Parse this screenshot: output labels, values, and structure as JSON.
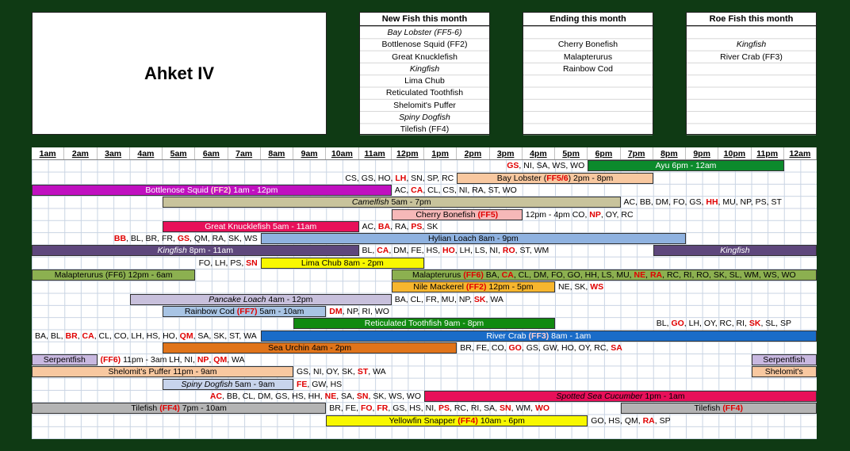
{
  "title": "Ahket IV",
  "panels": [
    {
      "key": "new",
      "header": "New Fish this month",
      "items": [
        {
          "t": "Bay Lobster (FF5-6)",
          "i": true
        },
        {
          "t": "Bottlenose Squid (FF2)",
          "i": false
        },
        {
          "t": "Great Knucklefish",
          "i": false
        },
        {
          "t": "Kingfish",
          "i": true
        },
        {
          "t": "Lima Chub",
          "i": false
        },
        {
          "t": "Reticulated Toothfish",
          "i": false
        },
        {
          "t": "Shelomit's Puffer",
          "i": false
        },
        {
          "t": "Spiny Dogfish",
          "i": true
        },
        {
          "t": "Tilefish (FF4)",
          "i": false
        }
      ]
    },
    {
      "key": "ending",
      "header": "Ending this month",
      "items": [
        {
          "t": "",
          "i": false
        },
        {
          "t": "Cherry Bonefish",
          "i": false
        },
        {
          "t": "Malapterurus",
          "i": false
        },
        {
          "t": "Rainbow Cod",
          "i": false
        }
      ]
    },
    {
      "key": "roe",
      "header": "Roe Fish this month",
      "items": [
        {
          "t": "",
          "i": false
        },
        {
          "t": "Kingfish",
          "i": true
        },
        {
          "t": "River Crab (FF3)",
          "i": false
        }
      ]
    }
  ],
  "hours": [
    "1am",
    "2am",
    "3am",
    "4am",
    "5am",
    "6am",
    "7am",
    "8am",
    "9am",
    "10am",
    "11am",
    "12pm",
    "1pm",
    "2pm",
    "3pm",
    "4pm",
    "5pm",
    "6pm",
    "7pm",
    "8pm",
    "9pm",
    "10pm",
    "11pm",
    "12am"
  ],
  "colors": {
    "background": "#0f3a14",
    "grid": "#c9d4e3"
  },
  "rows": [
    {
      "bars": [
        {
          "s": 17,
          "e": 23,
          "c": "#0c8a2c",
          "w": true,
          "label": [
            {
              "t": "Ayu  6pm - 12am"
            }
          ]
        }
      ],
      "texts": [
        {
          "s": 10,
          "e": 17,
          "align": "r",
          "parts": [
            {
              "t": "GS",
              "r": true
            },
            {
              "t": ", NI, SA, WS, WO"
            }
          ]
        }
      ]
    },
    {
      "bars": [
        {
          "s": 13,
          "e": 19,
          "c": "#f8c8a0",
          "label": [
            {
              "t": "Bay Lobster ("
            },
            {
              "t": "FF5/6",
              "r": true
            },
            {
              "t": ") 2pm - 8pm"
            }
          ]
        }
      ],
      "texts": [
        {
          "s": 6,
          "e": 13,
          "align": "r",
          "parts": [
            {
              "t": "CS, GS, HO, "
            },
            {
              "t": "LH",
              "r": true
            },
            {
              "t": ", SN, SP, RC"
            }
          ]
        }
      ]
    },
    {
      "bars": [
        {
          "s": 0,
          "e": 11,
          "c": "#c010c0",
          "w": true,
          "label": [
            {
              "t": "Bottlenose Squid "
            },
            {
              "t": "(FF2)",
              "r": true
            },
            {
              "t": "  1am - 12pm"
            }
          ]
        }
      ],
      "texts": [
        {
          "s": 11,
          "e": 24,
          "align": "l",
          "parts": [
            {
              "t": "AC, "
            },
            {
              "t": "CA",
              "r": true
            },
            {
              "t": ", CL, CS, NI, RA, ST, WO"
            }
          ]
        }
      ]
    },
    {
      "bars": [
        {
          "s": 4,
          "e": 18,
          "c": "#c8c39c",
          "label": [
            {
              "t": "Camelfish",
              "i": true
            },
            {
              "t": "  5am - 7pm"
            }
          ]
        }
      ],
      "texts": [
        {
          "s": 18,
          "e": 24,
          "align": "l",
          "parts": [
            {
              "t": "AC, BB, DM, FO, GS, "
            },
            {
              "t": "HH",
              "r": true
            },
            {
              "t": ", MU, NP, PS, ST"
            }
          ]
        }
      ]
    },
    {
      "bars": [
        {
          "s": 11,
          "e": 15,
          "c": "#f6b8b8",
          "label": [
            {
              "t": "Cherry Bonefish "
            },
            {
              "t": "(FF5)",
              "r": true
            }
          ]
        }
      ],
      "texts": [
        {
          "s": 15,
          "e": 24,
          "align": "l",
          "parts": [
            {
              "t": "  12pm - 4pm  CO, "
            },
            {
              "t": "NP",
              "r": true
            },
            {
              "t": ", OY, RC"
            }
          ]
        }
      ]
    },
    {
      "bars": [
        {
          "s": 4,
          "e": 10,
          "c": "#e8105a",
          "w": true,
          "label": [
            {
              "t": "Great Knucklefish  5am - 11am"
            }
          ]
        }
      ],
      "texts": [
        {
          "s": 10,
          "e": 20,
          "align": "l",
          "parts": [
            {
              "t": "AC, "
            },
            {
              "t": "BA",
              "r": true
            },
            {
              "t": ", RA, "
            },
            {
              "t": "PS",
              "r": true
            },
            {
              "t": ", SK"
            }
          ]
        }
      ]
    },
    {
      "bars": [
        {
          "s": 7,
          "e": 20,
          "c": "#8fb2e0",
          "label": [
            {
              "t": "Hylian Loach  8am - 9pm"
            }
          ]
        }
      ],
      "texts": [
        {
          "s": 0,
          "e": 7,
          "align": "r",
          "parts": [
            {
              "t": "BB",
              "r": true
            },
            {
              "t": ", BL, BR, FR, "
            },
            {
              "t": "GS",
              "r": true
            },
            {
              "t": ", QM, RA, SK, WS"
            }
          ]
        }
      ]
    },
    {
      "bars": [
        {
          "s": 0,
          "e": 10,
          "c": "#5e477c",
          "w": true,
          "label": [
            {
              "t": "Kingfish",
              "i": true
            },
            {
              "t": "  8pm - 11am"
            }
          ]
        },
        {
          "s": 19,
          "e": 24,
          "c": "#5e477c",
          "w": true,
          "label": [
            {
              "t": "Kingfish",
              "i": true
            }
          ]
        }
      ],
      "texts": [
        {
          "s": 10,
          "e": 19,
          "align": "l",
          "parts": [
            {
              "t": "BL, "
            },
            {
              "t": "CA",
              "r": true
            },
            {
              "t": ", DM, FE, HS, "
            },
            {
              "t": "HO",
              "r": true
            },
            {
              "t": ", LH, LS, NI, "
            },
            {
              "t": "RO",
              "r": true
            },
            {
              "t": ", ST, WM"
            }
          ]
        }
      ]
    },
    {
      "bars": [
        {
          "s": 7,
          "e": 12,
          "c": "#f8f800",
          "label": [
            {
              "t": "Lima Chub  8am - 2pm"
            }
          ]
        }
      ],
      "texts": [
        {
          "s": 0,
          "e": 7,
          "align": "r",
          "parts": [
            {
              "t": "FO, LH, PS, "
            },
            {
              "t": "SN",
              "r": true
            }
          ]
        }
      ]
    },
    {
      "bars": [
        {
          "s": 0,
          "e": 5,
          "c": "#8cb050",
          "label": [
            {
              "t": "Malapterurus (FF6)  12pm - 6am"
            }
          ]
        },
        {
          "s": 11,
          "e": 24,
          "c": "#8cb050",
          "label": [
            {
              "t": "Malapterurus "
            },
            {
              "t": "(FF6)",
              "r": true
            },
            {
              "t": "  BA, "
            },
            {
              "t": "CA",
              "r": true
            },
            {
              "t": ", CL, DM, FO, GO, HH, LS, MU, "
            },
            {
              "t": "NE",
              "r": true
            },
            {
              "t": ", "
            },
            {
              "t": "RA",
              "r": true
            },
            {
              "t": ", RC, RI, RO, SK, SL, WM, WS, WO"
            }
          ]
        }
      ],
      "texts": []
    },
    {
      "bars": [
        {
          "s": 11,
          "e": 16,
          "c": "#f7b62e",
          "label": [
            {
              "t": "Nile Mackerel "
            },
            {
              "t": "(FF2)",
              "r": true
            },
            {
              "t": "  12pm - 5pm"
            }
          ]
        }
      ],
      "texts": [
        {
          "s": 16,
          "e": 24,
          "align": "l",
          "parts": [
            {
              "t": "  NE, SK, "
            },
            {
              "t": "WS",
              "r": true
            }
          ]
        }
      ]
    },
    {
      "bars": [
        {
          "s": 3,
          "e": 11,
          "c": "#c8c0dc",
          "label": [
            {
              "t": "Pancake Loach",
              "i": true
            },
            {
              "t": "  4am - 12pm"
            }
          ]
        }
      ],
      "texts": [
        {
          "s": 11,
          "e": 24,
          "align": "l",
          "parts": [
            {
              "t": "BA, CL, FR, MU, NP, "
            },
            {
              "t": "SK",
              "r": true
            },
            {
              "t": ", WA"
            }
          ]
        }
      ]
    },
    {
      "bars": [
        {
          "s": 4,
          "e": 9,
          "c": "#a8c4e4",
          "label": [
            {
              "t": "Rainbow Cod "
            },
            {
              "t": "(FF7)",
              "r": true
            },
            {
              "t": "  5am - 10am"
            }
          ]
        }
      ],
      "texts": [
        {
          "s": 9,
          "e": 24,
          "align": "l",
          "parts": [
            {
              "t": "  "
            },
            {
              "t": "DM",
              "r": true
            },
            {
              "t": ", NP, RI, WO"
            }
          ]
        }
      ]
    },
    {
      "bars": [
        {
          "s": 8,
          "e": 16,
          "c": "#108a10",
          "w": true,
          "label": [
            {
              "t": "Reticulated Toothfish  9am - 8pm"
            }
          ]
        }
      ],
      "texts": [
        {
          "s": 19,
          "e": 24,
          "align": "l",
          "parts": [
            {
              "t": "  BL, "
            },
            {
              "t": "GO",
              "r": true
            },
            {
              "t": ", LH, OY, RC, RI, "
            },
            {
              "t": "SK",
              "r": true
            },
            {
              "t": ", SL, SP"
            }
          ]
        }
      ]
    },
    {
      "bars": [
        {
          "s": 7,
          "e": 24,
          "c": "#1a6cc8",
          "w": true,
          "label": [
            {
              "t": "River Crab "
            },
            {
              "t": "(FF3)",
              "r": true
            },
            {
              "t": "  8am - 1am"
            }
          ]
        }
      ],
      "texts": [
        {
          "s": 0,
          "e": 7,
          "align": "l",
          "parts": [
            {
              "t": "BA, BL, "
            },
            {
              "t": "BR",
              "r": true
            },
            {
              "t": ", "
            },
            {
              "t": "CA",
              "r": true
            },
            {
              "t": ", CL, CO, LH, HS, HO, "
            },
            {
              "t": "QM",
              "r": true
            },
            {
              "t": ", SA, SK, ST, WA"
            }
          ]
        }
      ]
    },
    {
      "bars": [
        {
          "s": 4,
          "e": 13,
          "c": "#e0741a",
          "label": [
            {
              "t": "Sea Urchin  4am - 2pm"
            }
          ]
        }
      ],
      "texts": [
        {
          "s": 13,
          "e": 24,
          "align": "l",
          "parts": [
            {
              "t": "  BR, FE, CO, "
            },
            {
              "t": "GO",
              "r": true
            },
            {
              "t": ", GS, GW, HO, OY, RC, "
            },
            {
              "t": "SA",
              "r": true
            }
          ]
        }
      ]
    },
    {
      "bars": [
        {
          "s": 0,
          "e": 2,
          "c": "#c8b8e0",
          "label": [
            {
              "t": "Serpentfish"
            }
          ]
        },
        {
          "s": 22,
          "e": 24,
          "c": "#c8b8e0",
          "label": [
            {
              "t": "Serpentfish"
            }
          ]
        }
      ],
      "texts": [
        {
          "s": 2,
          "e": 12,
          "align": "l",
          "parts": [
            {
              "t": "  "
            },
            {
              "t": "(FF6)",
              "r": true
            },
            {
              "t": "  11pm - 3am  LH, NI, "
            },
            {
              "t": "NP",
              "r": true
            },
            {
              "t": ", "
            },
            {
              "t": "QM",
              "r": true
            },
            {
              "t": ", WA"
            }
          ]
        }
      ]
    },
    {
      "bars": [
        {
          "s": 0,
          "e": 8,
          "c": "#f8c8a0",
          "label": [
            {
              "t": "Shelomit's Puffer  11pm - 9am"
            }
          ]
        },
        {
          "s": 22,
          "e": 24,
          "c": "#f8c8a0",
          "label": [
            {
              "t": "Shelomit's"
            }
          ]
        }
      ],
      "texts": [
        {
          "s": 8,
          "e": 14,
          "align": "l",
          "parts": [
            {
              "t": "  GS, NI, OY, SK, "
            },
            {
              "t": "ST",
              "r": true
            },
            {
              "t": ", WA"
            }
          ]
        }
      ]
    },
    {
      "bars": [
        {
          "s": 4,
          "e": 8,
          "c": "#c8d4ec",
          "label": [
            {
              "t": "Spiny Dogfish",
              "i": true
            },
            {
              "t": "  5am - 9am"
            }
          ]
        }
      ],
      "texts": [
        {
          "s": 8,
          "e": 14,
          "align": "l",
          "parts": [
            {
              "t": "  "
            },
            {
              "t": "FE",
              "r": true
            },
            {
              "t": ", GW, HS"
            }
          ]
        }
      ]
    },
    {
      "bars": [
        {
          "s": 12,
          "e": 24,
          "c": "#e8105a",
          "label": [
            {
              "t": "Spotted Sea Cucumber",
              "i": true
            },
            {
              "t": "  1pm - 1am"
            }
          ]
        }
      ],
      "texts": [
        {
          "s": 0,
          "e": 12,
          "align": "r",
          "parts": [
            {
              "t": "AC",
              "r": true
            },
            {
              "t": ", BB, CL, DM, GS, HS, HH, "
            },
            {
              "t": "NE",
              "r": true
            },
            {
              "t": ", SA, "
            },
            {
              "t": "SN",
              "r": true
            },
            {
              "t": ", SK, WS, WO"
            }
          ]
        }
      ]
    },
    {
      "bars": [
        {
          "s": 0,
          "e": 9,
          "c": "#b4b4b4",
          "label": [
            {
              "t": "Tilefish "
            },
            {
              "t": "(FF4)",
              "r": true
            },
            {
              "t": "  7pm - 10am"
            }
          ]
        },
        {
          "s": 18,
          "e": 24,
          "c": "#b4b4b4",
          "label": [
            {
              "t": "Tilefish "
            },
            {
              "t": "(FF4)",
              "r": true
            }
          ]
        }
      ],
      "texts": [
        {
          "s": 9,
          "e": 18,
          "align": "l",
          "parts": [
            {
              "t": "  BR, FE, "
            },
            {
              "t": "FO",
              "r": true
            },
            {
              "t": ", "
            },
            {
              "t": "FR",
              "r": true
            },
            {
              "t": ", GS, HS, NI, "
            },
            {
              "t": "PS",
              "r": true
            },
            {
              "t": ", RC, RI, SA, "
            },
            {
              "t": "SN",
              "r": true
            },
            {
              "t": ", WM, "
            },
            {
              "t": "WO",
              "r": true
            }
          ]
        }
      ]
    },
    {
      "bars": [
        {
          "s": 9,
          "e": 17,
          "c": "#f8f800",
          "label": [
            {
              "t": "Yellowfin Snapper "
            },
            {
              "t": "(FF4)",
              "r": true
            },
            {
              "t": "  10am - 6pm"
            }
          ]
        }
      ],
      "texts": [
        {
          "s": 17,
          "e": 24,
          "align": "l",
          "parts": [
            {
              "t": "  GO, HS, QM, "
            },
            {
              "t": "RA",
              "r": true
            },
            {
              "t": ", SP"
            }
          ]
        }
      ]
    }
  ]
}
